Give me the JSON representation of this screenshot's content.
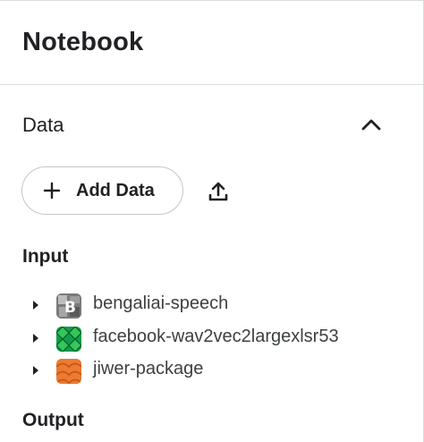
{
  "header": {
    "title": "Notebook"
  },
  "data_section": {
    "title": "Data",
    "collapse_icon": "chevron-up-icon",
    "add_data_label": "Add Data",
    "upload_icon": "upload-icon"
  },
  "input": {
    "title": "Input",
    "items": [
      {
        "label": "bengaliai-speech",
        "thumb": "bengali-dataset-thumbnail",
        "color": "#4a4a4a"
      },
      {
        "label": "facebook-wav2vec2largexlsr53",
        "thumb": "green-pattern-thumbnail",
        "color": "#34a853"
      },
      {
        "label": "jiwer-package",
        "thumb": "orange-pattern-thumbnail",
        "color": "#e8702a"
      }
    ]
  },
  "output": {
    "title": "Output"
  }
}
